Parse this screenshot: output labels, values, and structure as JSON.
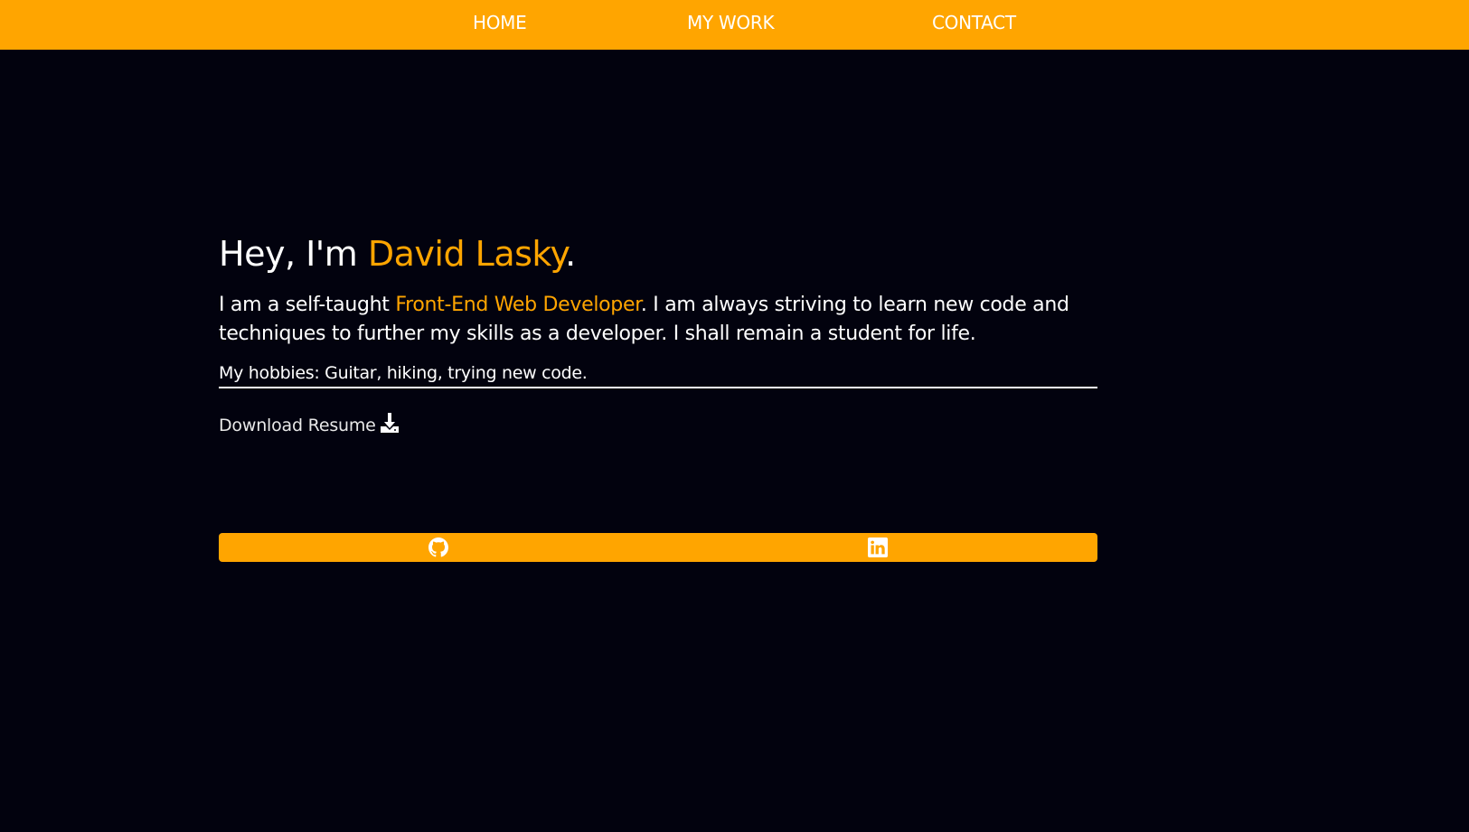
{
  "nav": {
    "home": "HOME",
    "work": "MY WORK",
    "contact": "CONTACT"
  },
  "intro": {
    "greeting_prefix": "Hey, I'm ",
    "name": "David Lasky",
    "greeting_suffix": ".",
    "bio_prefix": "I am a self-taught ",
    "role": "Front-End Web Developer",
    "bio_suffix": ". I am always striving to learn new code and techniques to further my skills as a developer. I shall remain a student for life.",
    "hobbies": "My hobbies: Guitar, hiking, trying new code.",
    "resume_label": "Download Resume"
  },
  "social": {
    "github_icon": "github-icon",
    "linkedin_icon": "linkedin-icon"
  },
  "colors": {
    "accent": "#ffa500",
    "background": "#02020e",
    "text": "#ffffff"
  }
}
